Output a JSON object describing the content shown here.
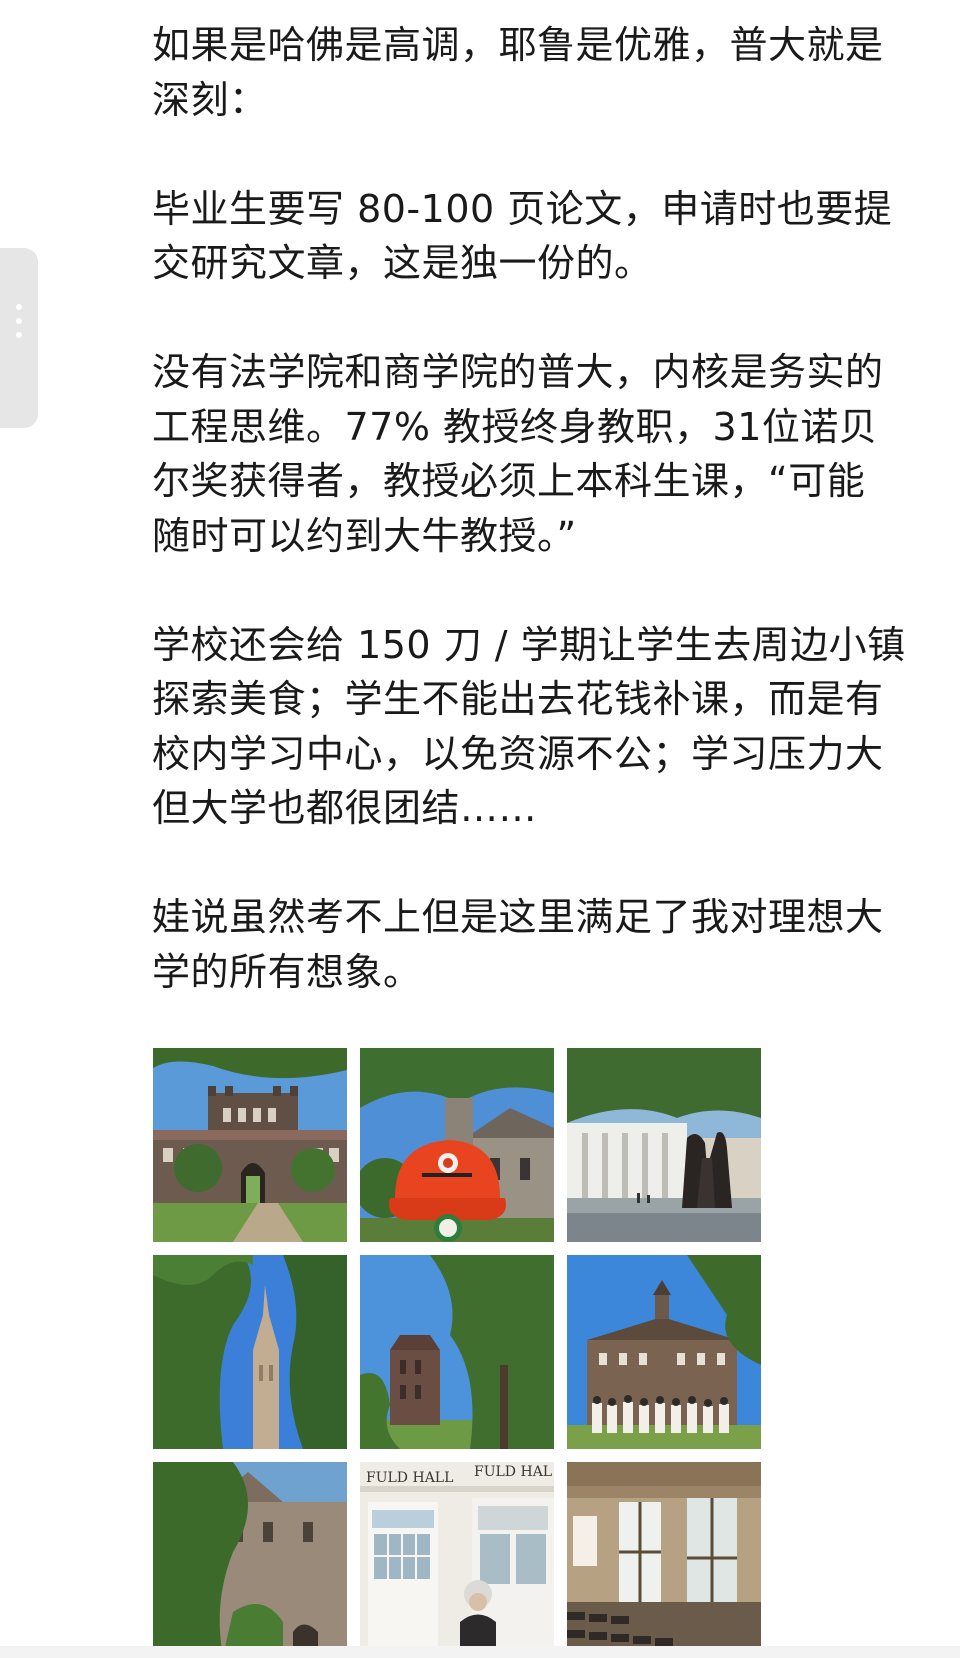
{
  "post": {
    "paragraphs": [
      [
        "如果是哈佛是高调，耶鲁是优雅，普大就是",
        "深刻："
      ],
      [
        "毕业生要写 80-100 页论文，申请时也要提",
        "交研究文章，这是独一份的。"
      ],
      [
        "没有法学院和商学院的普大，内核是务实的",
        "工程思维。77% 教授终身教职，31位诺贝",
        "尔奖获得者，教授必须上本科生课，“可能",
        "随时可以约到大牛教授。”"
      ],
      [
        "学校还会给 150 刀 / 学期让学生去周边小镇",
        "探索美食；学生不能出去花钱补课，而是有",
        "校内学习中心，以免资源不公；学习压力大",
        "但大学也都很团结……"
      ],
      [
        "娃说虽然考不上但是这里满足了我对理想大",
        "学的所有想象。"
      ]
    ]
  },
  "photos": [
    {
      "name": "photo-gothic-gate-building"
    },
    {
      "name": "photo-red-princeton-cap"
    },
    {
      "name": "photo-fountain-sculpture"
    },
    {
      "name": "photo-chapel-spire-trees"
    },
    {
      "name": "photo-tower-through-trees"
    },
    {
      "name": "photo-nassau-hall-group"
    },
    {
      "name": "photo-ivy-stone-building"
    },
    {
      "name": "photo-fuld-hall-einstein",
      "sign_text": [
        "FULD HALL",
        "FULD HAL"
      ]
    },
    {
      "name": "photo-classroom-interior"
    }
  ]
}
